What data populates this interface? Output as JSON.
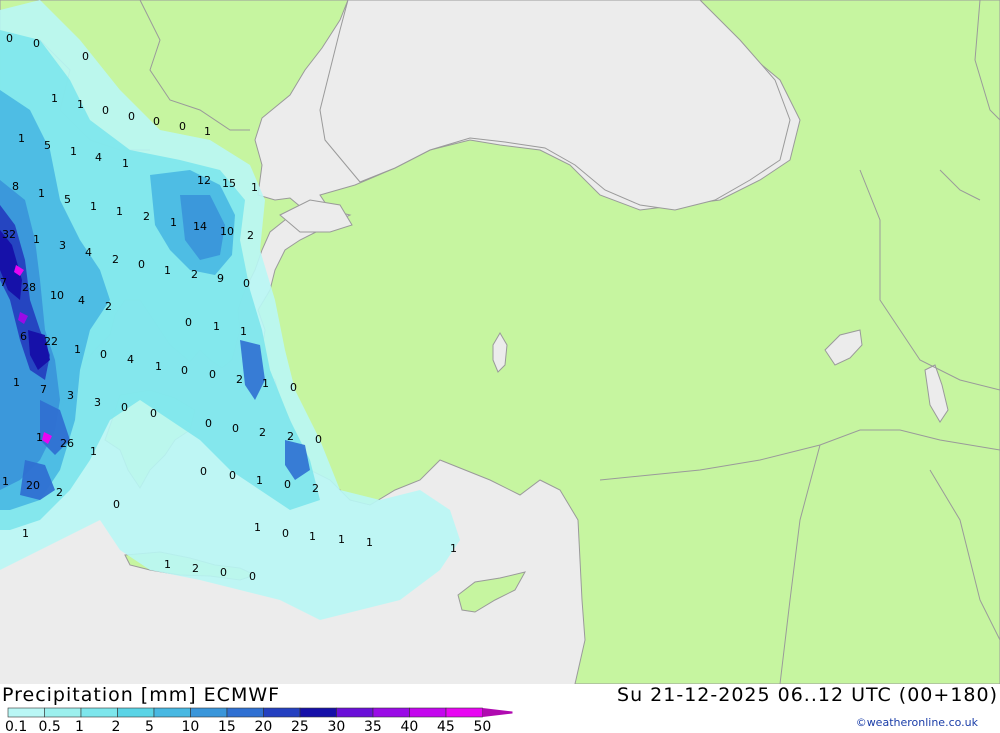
{
  "title": "Precipitation [mm] ECMWF",
  "datetime": "Su 21-12-2025 06..12 UTC (00+180)",
  "credit": "©weatheronline.co.uk",
  "colors": {
    "land": "#c6f5a0",
    "sea": "#ececec",
    "border": "#9a9a9a"
  },
  "legend": {
    "labels": [
      "0.1",
      "0.5",
      "1",
      "2",
      "5",
      "10",
      "15",
      "20",
      "25",
      "30",
      "35",
      "40",
      "45",
      "50"
    ],
    "colors": [
      "#b9f7f5",
      "#9cf0ee",
      "#7de6ec",
      "#5ad4e6",
      "#48b8e2",
      "#3a96da",
      "#2f70d2",
      "#2440c0",
      "#150fa8",
      "#6a0fd8",
      "#9a0be6",
      "#c406ee",
      "#e806f2",
      "#b00ab0"
    ]
  },
  "map_values": [
    "0",
    "0",
    "0",
    "1",
    "1",
    "0",
    "0",
    "0",
    "0",
    "1",
    "1",
    "5",
    "1",
    "4",
    "1",
    "8",
    "1",
    "5",
    "1",
    "1",
    "2",
    "1",
    "12",
    "15",
    "1",
    "32",
    "1",
    "3",
    "4",
    "2",
    "0",
    "1",
    "2",
    "14",
    "10",
    "2",
    "7",
    "28",
    "10",
    "4",
    "2",
    "9",
    "0",
    "0",
    "1",
    "1",
    "6",
    "22",
    "1",
    "0",
    "4",
    "1",
    "0",
    "0",
    "2",
    "1",
    "0",
    "1",
    "7",
    "3",
    "3",
    "0",
    "0",
    "0",
    "0",
    "2",
    "2",
    "0",
    "1",
    "26",
    "1",
    "0",
    "0",
    "1",
    "0",
    "2",
    "1",
    "20",
    "2",
    "0",
    "1",
    "1",
    "0",
    "1",
    "1",
    "1",
    "1",
    "1",
    "2",
    "0",
    "0"
  ]
}
